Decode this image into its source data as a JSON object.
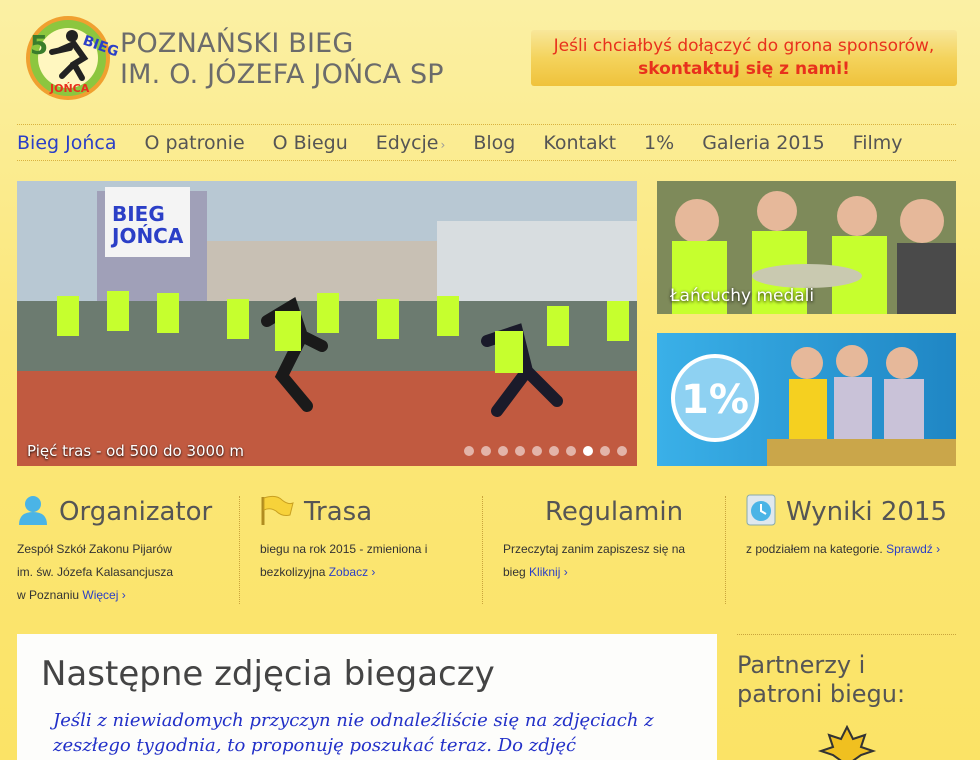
{
  "header": {
    "logo_alt": "5 Poznański Bieg Jońca",
    "title_line1": "POZNAŃSKI BIEG",
    "title_line2": "IM. O. JÓZEFA JOŃCA SP",
    "sponsor_line1": "Jeśli chciałbyś dołączyć do grona sponsorów,",
    "sponsor_line2": "skontaktuj się z nami!"
  },
  "nav": [
    {
      "label": "Bieg Jońca",
      "active": true
    },
    {
      "label": "O patronie"
    },
    {
      "label": "O Biegu"
    },
    {
      "label": "Edycje",
      "has_submenu": true
    },
    {
      "label": "Blog"
    },
    {
      "label": "Kontakt"
    },
    {
      "label": "1%"
    },
    {
      "label": "Galeria 2015"
    },
    {
      "label": "Filmy"
    }
  ],
  "nav_submenu_glyph": "›",
  "slider": {
    "caption": "Pięć tras - od 500 do 3000 m",
    "slide_count": 10,
    "active_index": 7
  },
  "side_images": [
    {
      "caption": "Łańcuchy medali"
    },
    {
      "caption": ""
    }
  ],
  "columns": [
    {
      "icon": "user-icon",
      "title": "Organizator",
      "lines": [
        "Zespół Szkół Zakonu Pijarów",
        "im. św. Józefa Kalasancjusza",
        "w Poznaniu"
      ],
      "link": "Więcej"
    },
    {
      "icon": "flag-icon",
      "title": "Trasa",
      "lines": [
        "biegu na rok 2015 - zmieniona i",
        "bezkolizyjna"
      ],
      "link": "Zobacz"
    },
    {
      "icon": "",
      "title": "Regulamin",
      "lines": [
        "Przeczytaj zanim zapiszesz się na",
        "bieg"
      ],
      "link": "Kliknij"
    },
    {
      "icon": "clock-icon",
      "title": "Wyniki 2015",
      "lines": [
        "z podziałem na kategorie."
      ],
      "link": "Sprawdź"
    }
  ],
  "link_glyph": "›",
  "content": {
    "title": "Następne zdjęcia biegaczy",
    "text": "Jeśli z niewiadomych przyczyn nie odnaleźliście się na zdjęciach z zeszłego tygodnia, to proponuję poszukać teraz. Do zdjęć"
  },
  "partners": {
    "title": "Partnerzy i patroni biegu:"
  },
  "colors": {
    "accent": "#2b3fc7",
    "sponsor_text": "#e8311c",
    "background": "#fbe77a"
  }
}
